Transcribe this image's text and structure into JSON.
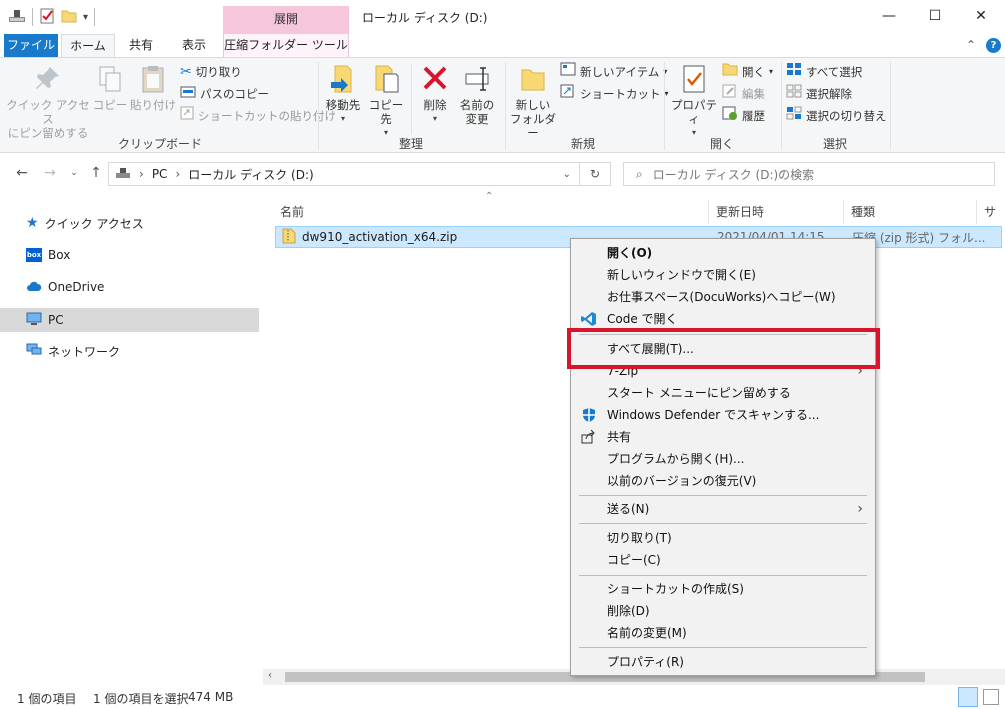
{
  "window": {
    "title": "ローカル ディスク (D:)",
    "context_tab_group": "展開",
    "minimize": "—",
    "maximize": "☐",
    "close": "✕"
  },
  "tabs": [
    "ファイル",
    "ホーム",
    "共有",
    "表示",
    "圧縮フォルダー ツール"
  ],
  "ribbon": {
    "clipboard": {
      "label": "クリップボード",
      "pin_line1": "クイック アクセス",
      "pin_line2": "にピン留めする",
      "copy": "コピー",
      "paste": "貼り付け",
      "cut": "切り取り",
      "copy_path": "パスのコピー",
      "paste_shortcut": "ショートカットの貼り付け"
    },
    "organize": {
      "label": "整理",
      "move_to": "移動先",
      "copy_to": "コピー先",
      "delete": "削除",
      "rename_line1": "名前の",
      "rename_line2": "変更"
    },
    "new": {
      "label": "新規",
      "new_folder_line1": "新しい",
      "new_folder_line2": "フォルダー",
      "new_item": "新しいアイテム",
      "shortcut": "ショートカット"
    },
    "open": {
      "label": "開く",
      "properties": "プロパティ",
      "open": "開く",
      "edit": "編集",
      "history": "履歴"
    },
    "select": {
      "label": "選択",
      "select_all": "すべて選択",
      "select_none": "選択解除",
      "invert": "選択の切り替え"
    }
  },
  "address": {
    "path": [
      "PC",
      "ローカル ディスク (D:)"
    ],
    "search_placeholder": "ローカル ディスク (D:)の検索"
  },
  "navpane": {
    "items": [
      {
        "label": "クイック アクセス",
        "icon": "star-icon"
      },
      {
        "label": "Box",
        "icon": "box-icon"
      },
      {
        "label": "OneDrive",
        "icon": "cloud-icon"
      },
      {
        "label": "PC",
        "icon": "pc-icon",
        "selected": true
      },
      {
        "label": "ネットワーク",
        "icon": "network-icon"
      }
    ]
  },
  "filelist": {
    "columns": [
      "名前",
      "更新日時",
      "種類",
      "サイ"
    ],
    "files": [
      {
        "name": "dw910_activation_x64.zip",
        "modified": "2021/04/01 14:15",
        "type": "圧縮 (zip 形式) フォル..."
      }
    ]
  },
  "context_menu": {
    "items": [
      "開く(O)",
      "新しいウィンドウで開く(E)",
      "お仕事スペース(DocuWorks)へコピー(W)",
      "Code で開く",
      "すべて展開(T)...",
      "7-Zip",
      "スタート メニューにピン留めする",
      "Windows Defender でスキャンする...",
      "共有",
      "プログラムから開く(H)...",
      "以前のバージョンの復元(V)",
      "送る(N)",
      "切り取り(T)",
      "コピー(C)",
      "ショートカットの作成(S)",
      "削除(D)",
      "名前の変更(M)",
      "プロパティ(R)"
    ]
  },
  "status": {
    "count": "1 個の項目",
    "selected": "1 個の項目を選択",
    "size": "474 MB"
  },
  "colors": {
    "file_tab": "#1979ca",
    "context_tab": "#f5c6dc",
    "selection": "#cce8ff",
    "highlight_box": "#d9142d"
  }
}
